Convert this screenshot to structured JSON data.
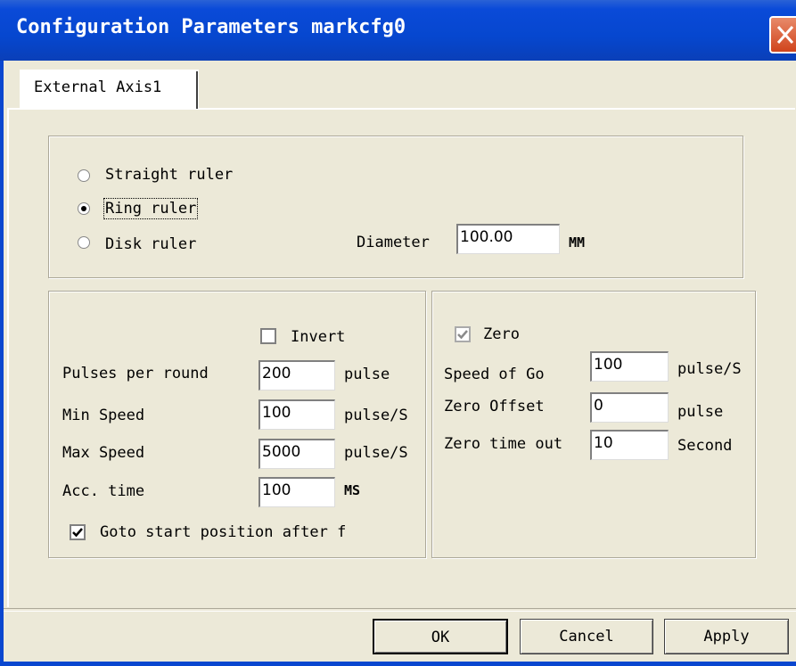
{
  "window": {
    "title": "Configuration Parameters markcfg0"
  },
  "tabs": [
    {
      "label": "External Axis1",
      "selected": true
    }
  ],
  "ruler": {
    "options": [
      {
        "label": "Straight ruler",
        "checked": false
      },
      {
        "label": "Ring ruler",
        "checked": true
      },
      {
        "label": "Disk ruler",
        "checked": false
      }
    ],
    "diameter_label": "Diameter",
    "diameter_value": "100.00",
    "diameter_unit": "MM"
  },
  "motor": {
    "invert_label": "Invert",
    "invert_checked": false,
    "pulses_label": "Pulses per round",
    "pulses_value": "200",
    "pulses_unit": "pulse",
    "min_speed_label": "Min Speed",
    "min_speed_value": "100",
    "min_speed_unit": "pulse/S",
    "max_speed_label": "Max Speed",
    "max_speed_value": "5000",
    "max_speed_unit": "pulse/S",
    "acc_label": "Acc. time",
    "acc_value": "100",
    "acc_unit": "MS",
    "goto_label": "Goto start position after f",
    "goto_checked": true
  },
  "zero": {
    "zero_label": "Zero",
    "zero_checked": true,
    "speed_label": "Speed of Go",
    "speed_value": "100",
    "speed_unit": "pulse/S",
    "offset_label": "Zero Offset",
    "offset_value": "0",
    "offset_unit": "pulse",
    "timeout_label": "Zero time out",
    "timeout_value": "10",
    "timeout_unit": "Second"
  },
  "buttons": {
    "ok": "OK",
    "cancel": "Cancel",
    "apply": "Apply"
  }
}
